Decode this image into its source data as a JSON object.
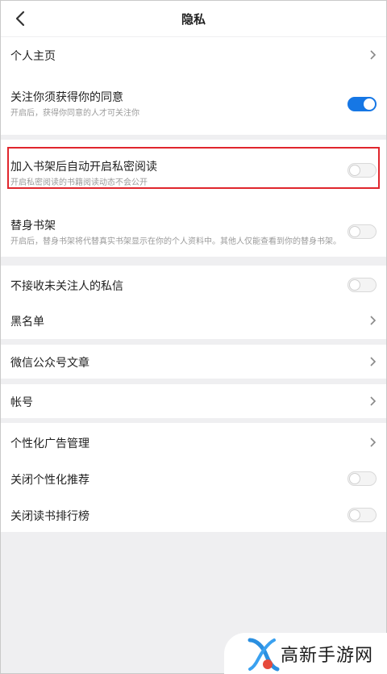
{
  "header": {
    "title": "隐私"
  },
  "items": {
    "homepage": {
      "label": "个人主页"
    },
    "follow_consent": {
      "label": "关注你须获得你的同意",
      "sub": "开启后，获得你同意的人才可关注你",
      "on": true
    },
    "private_reading": {
      "label": "加入书架后自动开启私密阅读",
      "sub": "开启私密阅读的书籍阅读动态不会公开",
      "on": false
    },
    "substitute_shelf": {
      "label": "替身书架",
      "sub": "开启后，替身书架将代替真实书架显示在你的个人资料中。其他人仅能查看到你的替身书架。",
      "on": false
    },
    "no_stranger_msg": {
      "label": "不接收未关注人的私信",
      "on": false
    },
    "blacklist": {
      "label": "黑名单"
    },
    "wechat_articles": {
      "label": "微信公众号文章"
    },
    "account": {
      "label": "帐号"
    },
    "ad_management": {
      "label": "个性化广告管理"
    },
    "close_recommend": {
      "label": "关闭个性化推荐",
      "on": false
    },
    "close_ranking": {
      "label": "关闭读书排行榜",
      "on": false
    }
  },
  "watermark": {
    "text": "高新手游网"
  },
  "colors": {
    "accent": "#1677e5",
    "highlight": "#e0262d"
  }
}
